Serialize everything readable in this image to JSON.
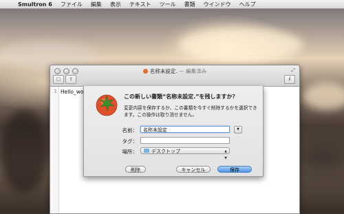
{
  "menubar": {
    "app_name": "Smultron 6",
    "items": [
      "ファイル",
      "編集",
      "表示",
      "テキスト",
      "ツール",
      "書類",
      "ウインドウ",
      "ヘルプ"
    ]
  },
  "window": {
    "title": "名称未設定.",
    "edited_suffix": " — 編集済み",
    "line_number": "1",
    "content": "Hello_worl"
  },
  "dialog": {
    "title": "この新しい書類“名称未設定.”を残しますか？",
    "message": "変更内容を保存するか、この書類を今すぐ削除するかを選択できます。この操作は取り消せません。",
    "name_label": "名前：",
    "name_value": "名称未設定",
    "tags_label": "タグ：",
    "tags_value": "",
    "location_label": "場所：",
    "location_value": "デスクトップ",
    "delete_label": "削除",
    "cancel_label": "キャンセル",
    "save_label": "保存"
  },
  "colors": {
    "accent": "#4f95e4",
    "focus_ring": "#6a9bd8"
  }
}
